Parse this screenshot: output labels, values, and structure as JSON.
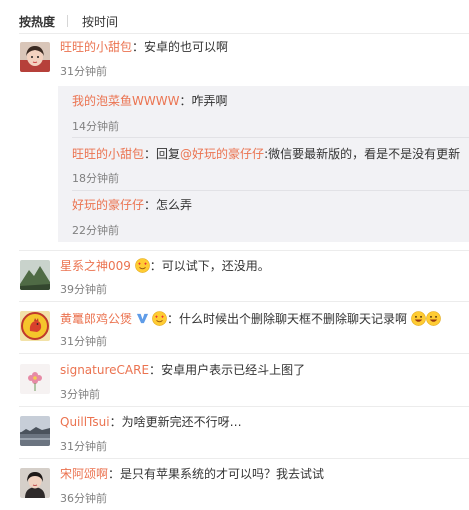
{
  "tabs": [
    "按热度",
    "按时间"
  ],
  "colon": "：",
  "comments": [
    {
      "user": "旺旺的小甜包",
      "text": "安卓的也可以啊",
      "time": "31分钟前",
      "avatar": "girl-avatar",
      "replies": [
        {
          "user": "我的泡菜鱼WWWW",
          "text": "咋弄啊",
          "time": "14分钟前"
        },
        {
          "user": "旺旺的小甜包",
          "text": "回复",
          "mention": "@好玩的豪仔仔",
          "text2": ":微信要最新版的，看是不是没有更新",
          "time": "18分钟前"
        },
        {
          "user": "好玩的豪仔仔",
          "text": "怎么弄",
          "time": "22分钟前"
        }
      ]
    },
    {
      "user": "星系之神009",
      "text": "可以试下，还没用。",
      "time": "39分钟前",
      "avatar": "mountain-avatar",
      "emoji": "heart-eyes-emoji"
    },
    {
      "user": "黄鼍郎鸡公煲",
      "text": "什么时候出个删除聊天框不删除聊天记录啊",
      "time": "31分钟前",
      "avatar": "rooster-avatar",
      "badge": "v-verified-badge",
      "emoji": "heart-eyes-emoji",
      "end_emoji": [
        "grin-emoji",
        "grin-emoji"
      ]
    },
    {
      "user": "signatureCARE",
      "text": "安卓用户表示已经斗上图了",
      "time": "3分钟前",
      "avatar": "flower-avatar"
    },
    {
      "user": "QuillTsui",
      "text": "为啥更新完还不行呀…",
      "time": "31分钟前",
      "avatar": "landscape-avatar"
    },
    {
      "user": "宋阿颂啊",
      "text": "是只有苹果系统的才可以吗？我去试试",
      "time": "36分钟前",
      "avatar": "woman-avatar"
    }
  ],
  "colors": {
    "username": "#eb7350",
    "text": "#333333",
    "time": "#808080",
    "reply_bg": "#f2f2f5",
    "badge": "#5f9ce8"
  }
}
